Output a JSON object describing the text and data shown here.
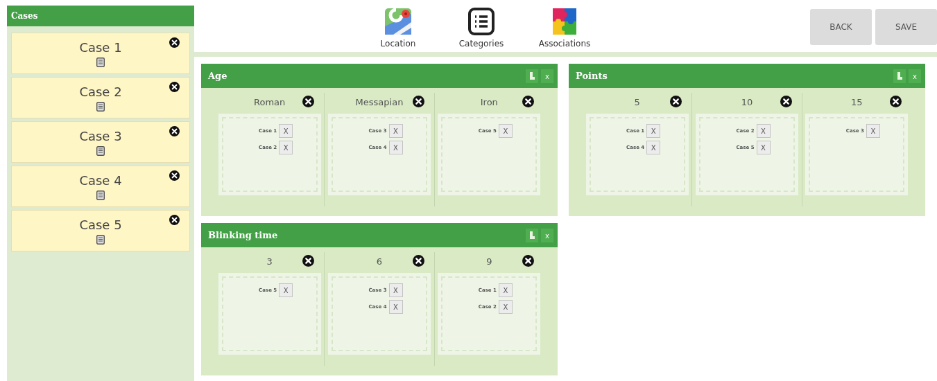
{
  "sidebar": {
    "title": "Cases",
    "cases": [
      {
        "name": "Case 1"
      },
      {
        "name": "Case 2"
      },
      {
        "name": "Case 3"
      },
      {
        "name": "Case 4"
      },
      {
        "name": "Case 5"
      }
    ]
  },
  "toolbar": {
    "tools": [
      {
        "label": "Location",
        "kind": "map"
      },
      {
        "label": "Categories",
        "kind": "list"
      },
      {
        "label": "Associations",
        "kind": "puzzle"
      }
    ],
    "buttons": [
      "BACK",
      "SAVE"
    ]
  },
  "panels": [
    {
      "title": "Age",
      "close": "x",
      "groups": [
        {
          "label": "Roman",
          "cases": [
            {
              "name": "Case 1",
              "remove": "X"
            },
            {
              "name": "Case 2",
              "remove": "X"
            }
          ]
        },
        {
          "label": "Messapian",
          "cases": [
            {
              "name": "Case 3",
              "remove": "X"
            },
            {
              "name": "Case 4",
              "remove": "X"
            }
          ]
        },
        {
          "label": "Iron",
          "cases": [
            {
              "name": "Case 5",
              "remove": "X"
            }
          ]
        }
      ]
    },
    {
      "title": "Points",
      "close": "x",
      "groups": [
        {
          "label": "5",
          "cases": [
            {
              "name": "Case 1",
              "remove": "X"
            },
            {
              "name": "Case 4",
              "remove": "X"
            }
          ]
        },
        {
          "label": "10",
          "cases": [
            {
              "name": "Case 2",
              "remove": "X"
            },
            {
              "name": "Case 5",
              "remove": "X"
            }
          ]
        },
        {
          "label": "15",
          "cases": [
            {
              "name": "Case 3",
              "remove": "X"
            }
          ]
        }
      ]
    },
    {
      "title": "Blinking time",
      "close": "x",
      "groups": [
        {
          "label": "3",
          "cases": [
            {
              "name": "Case 5",
              "remove": "X"
            }
          ]
        },
        {
          "label": "6",
          "cases": [
            {
              "name": "Case 3",
              "remove": "X"
            },
            {
              "name": "Case 4",
              "remove": "X"
            }
          ]
        },
        {
          "label": "9",
          "cases": [
            {
              "name": "Case 1",
              "remove": "X"
            },
            {
              "name": "Case 2",
              "remove": "X"
            }
          ]
        }
      ]
    }
  ]
}
